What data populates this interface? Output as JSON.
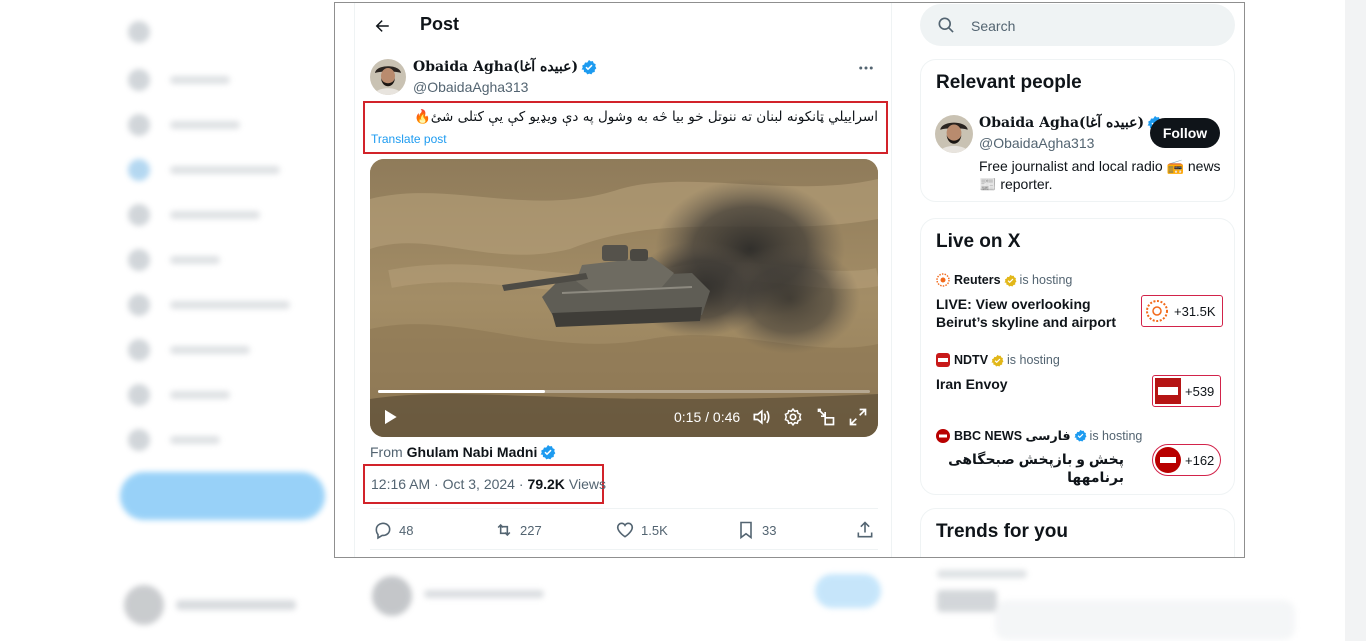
{
  "header": {
    "title": "Post"
  },
  "post": {
    "author": {
      "name": "Obaida Agha(عبیده آغا)",
      "handle": "@ObaidaAgha313"
    },
    "text": "اسراییلي ټانکونه لبنان ته ننوتل خو بیا څه به وشول په دې ویډیو کې یې کتلی شئ🔥",
    "translate_label": "Translate post",
    "video": {
      "time": "0:15 / 0:46",
      "progress_fraction": 0.34
    },
    "from_prefix": "From",
    "from_name": "Ghulam Nabi Madni",
    "timestamp": "12:16 AM · Oct 3, 2024 ·",
    "views_count": "79.2K",
    "views_label": "Views",
    "stats": {
      "replies": "48",
      "reposts": "227",
      "likes": "1.5K",
      "bookmarks": "33"
    }
  },
  "sidebar": {
    "search_placeholder": "Search",
    "relevant_people": {
      "title": "Relevant people",
      "name": "Obaida Agha(عبیده آغا)",
      "handle": "@ObaidaAgha313",
      "follow_label": "Follow",
      "bio": "Free journalist and local radio 📻 news 📰 reporter."
    },
    "live": {
      "title": "Live on X",
      "hosting_label": "is hosting",
      "items": [
        {
          "host": "Reuters",
          "title": "LIVE: View overlooking Beirut’s skyline and airport",
          "listeners": "+31.5K"
        },
        {
          "host": "NDTV",
          "title": "Iran Envoy",
          "listeners": "+539"
        },
        {
          "host": "BBC NEWS فارسی",
          "title": "پخش و بازپخش صبحگاهی برنامهها",
          "listeners": "+162"
        }
      ]
    },
    "trends_title": "Trends for you"
  },
  "colors": {
    "accent": "#1d9bf0",
    "highlight": "#d2232a",
    "text": "#0f1419",
    "muted": "#536471"
  }
}
